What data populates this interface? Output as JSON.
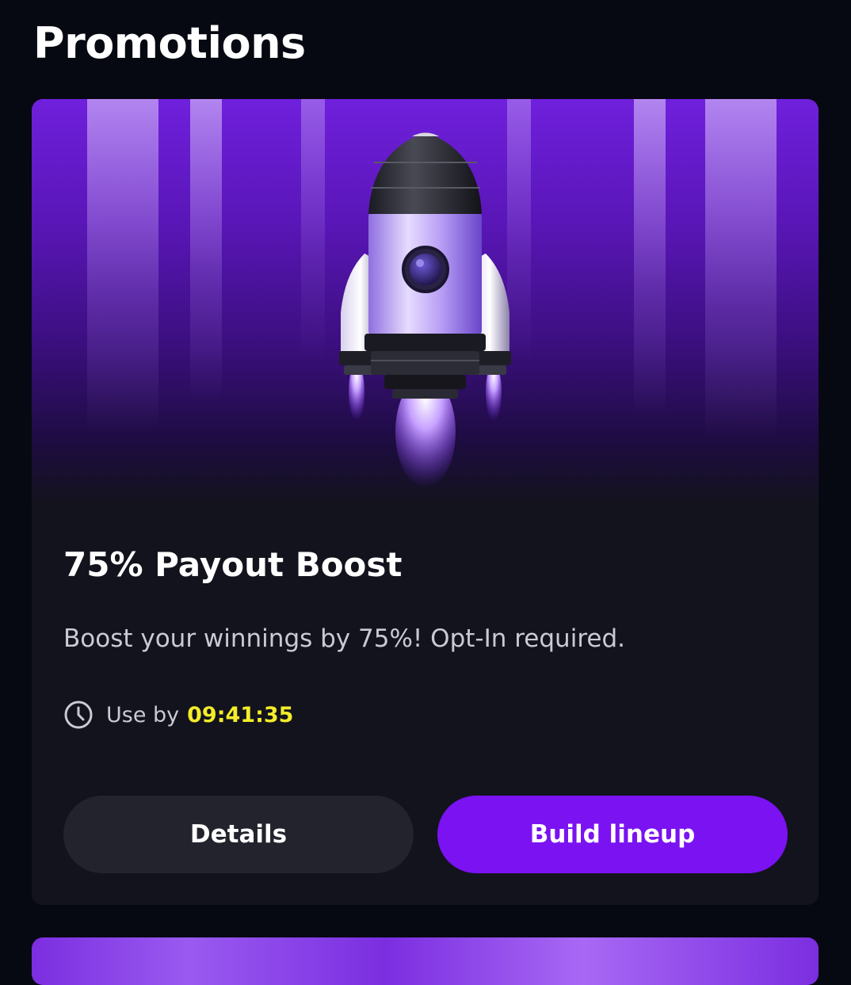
{
  "page": {
    "title": "Promotions"
  },
  "promo": {
    "title": "75% Payout Boost",
    "description": "Boost your winnings by 75%! Opt-In required.",
    "deadline_label": "Use by",
    "deadline_time": "09:41:35",
    "details_label": "Details",
    "cta_label": "Build lineup",
    "hero_icon": "rocket-illustration"
  },
  "colors": {
    "background": "#070912",
    "card": "#13131d",
    "accent": "#7a12f2",
    "timer": "#f3ec2b",
    "secondary_button": "#22232c"
  }
}
